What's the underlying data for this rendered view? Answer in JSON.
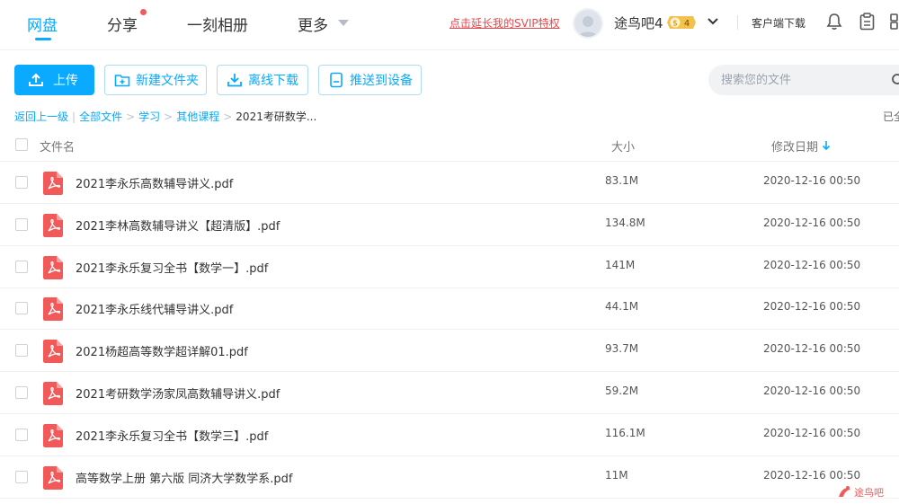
{
  "nav": {
    "items": [
      {
        "label": "网盘",
        "active": true
      },
      {
        "label": "分享",
        "has_dot": true
      },
      {
        "label": "一刻相册"
      },
      {
        "label": "更多",
        "has_caret": true
      }
    ],
    "svip_link": "点击延长我的SVIP特权",
    "username": "途鸟吧4",
    "vip_badge_level": "4",
    "client_download": "客户端下载"
  },
  "toolbar": {
    "upload": "上传",
    "new_folder": "新建文件夹",
    "offline_download": "离线下载",
    "push_device": "推送到设备",
    "search_placeholder": "搜索您的文件"
  },
  "breadcrumb": {
    "back": "返回上一级",
    "items": [
      "全部文件",
      "学习",
      "其他课程"
    ],
    "current": "2021考研数学...",
    "right_text": "已全"
  },
  "table": {
    "headers": {
      "name": "文件名",
      "size": "大小",
      "date": "修改日期"
    },
    "sort": "date-desc",
    "rows": [
      {
        "name": "2021李永乐高数辅导讲义.pdf",
        "size": "83.1M",
        "date": "2020-12-16 00:50"
      },
      {
        "name": "2021李林高数辅导讲义【超清版】.pdf",
        "size": "134.8M",
        "date": "2020-12-16 00:50"
      },
      {
        "name": "2021李永乐复习全书【数学一】.pdf",
        "size": "141M",
        "date": "2020-12-16 00:50"
      },
      {
        "name": "2021李永乐线代辅导讲义.pdf",
        "size": "44.1M",
        "date": "2020-12-16 00:50"
      },
      {
        "name": "2021杨超高等数学超详解01.pdf",
        "size": "93.7M",
        "date": "2020-12-16 00:50"
      },
      {
        "name": "2021考研数学汤家凤高数辅导讲义.pdf",
        "size": "59.2M",
        "date": "2020-12-16 00:50"
      },
      {
        "name": "2021李永乐复习全书【数学三】.pdf",
        "size": "116.1M",
        "date": "2020-12-16 00:50"
      },
      {
        "name": "高等数学上册 第六版 同济大学数学系.pdf",
        "size": "11M",
        "date": "2020-12-16 00:50"
      }
    ]
  },
  "watermark": "途鸟吧",
  "colors": {
    "accent": "#09aaff",
    "pdf": "#f25a5a",
    "svip": "#e8464b"
  }
}
